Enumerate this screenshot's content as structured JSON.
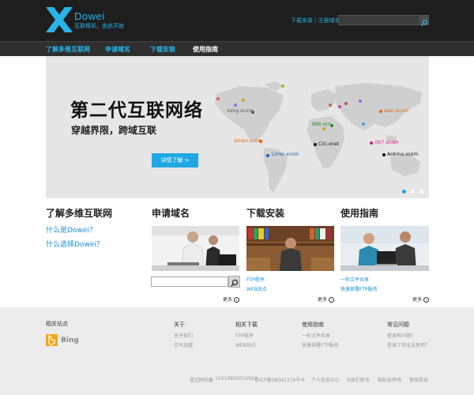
{
  "header": {
    "logo_name": "Dowei",
    "logo_tagline": "互联精彩，由此开始",
    "links": [
      "下载安装",
      "注册域名"
    ],
    "search_placeholder": ""
  },
  "nav": {
    "items": [
      "了解多维互联网",
      "申请域名",
      "下载安装",
      "使用指南"
    ],
    "active_index": 3
  },
  "banner": {
    "title": "第二代互联网络",
    "subtitle": "穿越界限，跨域互联",
    "button_label": "详情了解 >",
    "cities": [
      {
        "label": "ming.xcom",
        "color": "#555555"
      },
      {
        "label": "888.xcn",
        "color": "#2a8a2a"
      },
      {
        "label": "alen.xcom",
        "color": "#e8660a"
      },
      {
        "label": "simen.xcom",
        "color": "#e8660a"
      },
      {
        "label": "Cici.xnet",
        "color": "#111111"
      },
      {
        "label": "007.xcom",
        "color": "#d6197a"
      },
      {
        "label": "Limei.xcom",
        "color": "#1a5fb4"
      },
      {
        "label": "Aobma.xcom",
        "color": "#111111"
      }
    ],
    "slide_count": 3,
    "active_slide": 0
  },
  "columns": {
    "about": {
      "title": "了解多维互联网",
      "links": [
        "什么是Dowei？",
        "什么选择Dowei？"
      ]
    },
    "domain": {
      "title": "申请域名",
      "search_placeholder": "",
      "more": "更多"
    },
    "download": {
      "title": "下载安装",
      "links": [
        "FTP程序",
        "WEB站点"
      ],
      "more": "更多"
    },
    "guide": {
      "title": "使用指南",
      "links": [
        "一秒文件共享",
        "快速部署FTP服务"
      ],
      "more": "更多"
    }
  },
  "footer": {
    "partners_title": "相关站点",
    "bing_label": "Bing",
    "sections": [
      {
        "title": "关于",
        "items": [
          "关于我们",
          "合作加盟"
        ]
      },
      {
        "title": "相关下载",
        "items": [
          "FTP程序",
          "WEB站点"
        ]
      },
      {
        "title": "使用指南",
        "items": [
          "一秒文件共享",
          "快速部署FTP服务"
        ]
      },
      {
        "title": "常见问题",
        "items": [
          "登录有问题？",
          "登录了但无法使用？"
        ]
      }
    ],
    "bottom": [
      "登记网站备",
      "11010802019597",
      "粤ICP备08042379号卡",
      "个人信息中心",
      "与我们联系",
      "隐私权声明",
      "使用条款"
    ]
  },
  "colors": {
    "accent": "#28b4e8",
    "link": "#1b8fd3",
    "button": "#1fa8e4",
    "header_bg": "#1e1e1e",
    "nav_bg": "#2f2f2f",
    "footer_bg": "#ececec"
  }
}
